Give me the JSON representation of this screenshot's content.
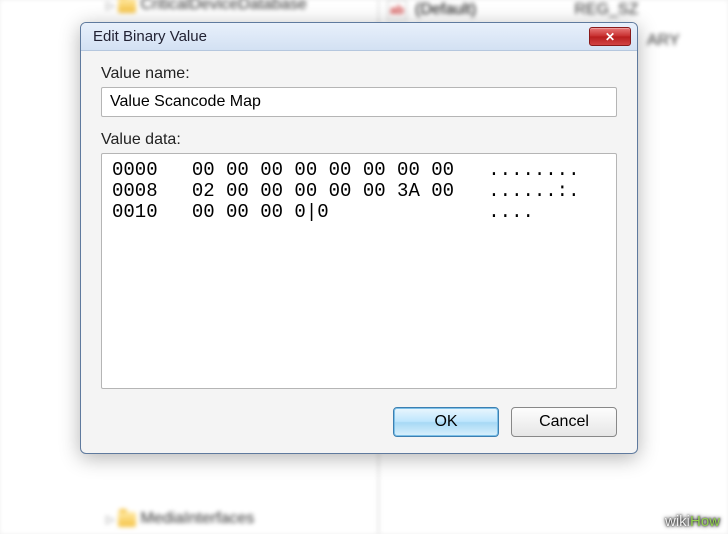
{
  "background": {
    "tree_items": {
      "top": "CriticalDeviceDatabase",
      "bottom": "MediaInterfaces"
    },
    "reg_default": "(Default)",
    "reg_type": "REG_SZ",
    "reg_type_right": "ARY",
    "string_icon_label": "ab"
  },
  "dialog": {
    "title": "Edit Binary Value",
    "close_glyph": "✕",
    "value_name_label": "Value name:",
    "value_name": "Value Scancode Map",
    "value_data_label": "Value data:",
    "hex_display": "0000   00 00 00 00 00 00 00 00   ........\n0008   02 00 00 00 00 00 3A 00   ......:.\n0010   00 00 00 0|0              ....",
    "buttons": {
      "ok": "OK",
      "cancel": "Cancel"
    }
  },
  "watermark": {
    "prefix": "wiki",
    "suffix": "How"
  }
}
